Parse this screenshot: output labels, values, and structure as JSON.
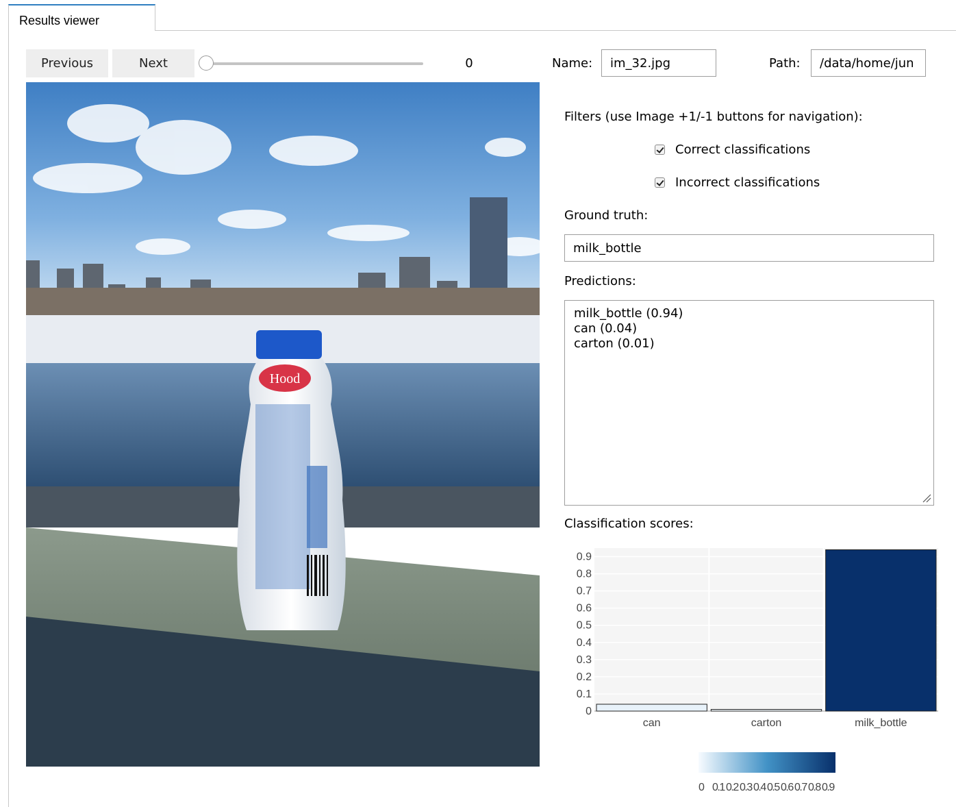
{
  "tab": {
    "label": "Results viewer"
  },
  "controls": {
    "previous_label": "Previous",
    "next_label": "Next",
    "slider_value": "0",
    "name_label": "Name:",
    "name_value": "im_32.jpg",
    "path_label": "Path:",
    "path_value": "/data/home/jun"
  },
  "filters": {
    "heading": "Filters (use Image +1/-1 buttons for navigation):",
    "correct_label": "Correct classifications",
    "correct_checked": true,
    "incorrect_label": "Incorrect classifications",
    "incorrect_checked": true
  },
  "ground_truth": {
    "label": "Ground truth:",
    "value": "milk_bottle"
  },
  "predictions": {
    "label": "Predictions:",
    "lines": [
      "milk_bottle (0.94)",
      "can (0.04)",
      "carton (0.01)"
    ]
  },
  "scores": {
    "label": "Classification scores:"
  },
  "colors": {
    "accent_tab": "#2f7fc1",
    "bar_max": "#08306b",
    "bar_min": "#f7fbff"
  },
  "chart_data": {
    "type": "bar",
    "categories": [
      "can",
      "carton",
      "milk_bottle"
    ],
    "values": [
      0.04,
      0.01,
      0.94
    ],
    "ylim": [
      0,
      0.95
    ],
    "yticks": [
      "0",
      "0.1",
      "0.2",
      "0.3",
      "0.4",
      "0.5",
      "0.6",
      "0.7",
      "0.8",
      "0.9"
    ],
    "colorscale": "Blues",
    "colorbar_ticks": [
      "0",
      "0.1",
      "0.2",
      "0.3",
      "0.4",
      "0.5",
      "0.6",
      "0.7",
      "0.8",
      "0.9"
    ],
    "grid": true
  }
}
